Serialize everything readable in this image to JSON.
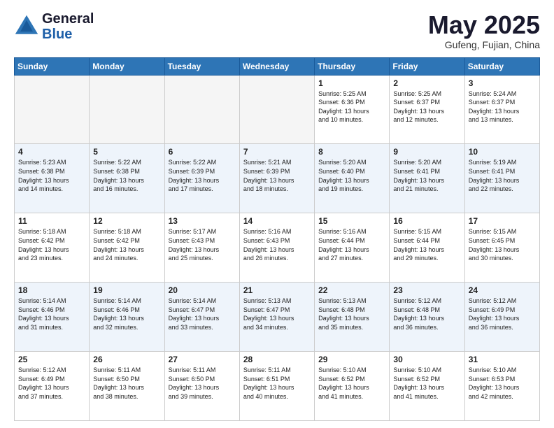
{
  "header": {
    "logo_general": "General",
    "logo_blue": "Blue",
    "month_title": "May 2025",
    "location": "Gufeng, Fujian, China"
  },
  "weekdays": [
    "Sunday",
    "Monday",
    "Tuesday",
    "Wednesday",
    "Thursday",
    "Friday",
    "Saturday"
  ],
  "weeks": [
    [
      {
        "day": "",
        "text": ""
      },
      {
        "day": "",
        "text": ""
      },
      {
        "day": "",
        "text": ""
      },
      {
        "day": "",
        "text": ""
      },
      {
        "day": "1",
        "text": "Sunrise: 5:25 AM\nSunset: 6:36 PM\nDaylight: 13 hours\nand 10 minutes."
      },
      {
        "day": "2",
        "text": "Sunrise: 5:25 AM\nSunset: 6:37 PM\nDaylight: 13 hours\nand 12 minutes."
      },
      {
        "day": "3",
        "text": "Sunrise: 5:24 AM\nSunset: 6:37 PM\nDaylight: 13 hours\nand 13 minutes."
      }
    ],
    [
      {
        "day": "4",
        "text": "Sunrise: 5:23 AM\nSunset: 6:38 PM\nDaylight: 13 hours\nand 14 minutes."
      },
      {
        "day": "5",
        "text": "Sunrise: 5:22 AM\nSunset: 6:38 PM\nDaylight: 13 hours\nand 16 minutes."
      },
      {
        "day": "6",
        "text": "Sunrise: 5:22 AM\nSunset: 6:39 PM\nDaylight: 13 hours\nand 17 minutes."
      },
      {
        "day": "7",
        "text": "Sunrise: 5:21 AM\nSunset: 6:39 PM\nDaylight: 13 hours\nand 18 minutes."
      },
      {
        "day": "8",
        "text": "Sunrise: 5:20 AM\nSunset: 6:40 PM\nDaylight: 13 hours\nand 19 minutes."
      },
      {
        "day": "9",
        "text": "Sunrise: 5:20 AM\nSunset: 6:41 PM\nDaylight: 13 hours\nand 21 minutes."
      },
      {
        "day": "10",
        "text": "Sunrise: 5:19 AM\nSunset: 6:41 PM\nDaylight: 13 hours\nand 22 minutes."
      }
    ],
    [
      {
        "day": "11",
        "text": "Sunrise: 5:18 AM\nSunset: 6:42 PM\nDaylight: 13 hours\nand 23 minutes."
      },
      {
        "day": "12",
        "text": "Sunrise: 5:18 AM\nSunset: 6:42 PM\nDaylight: 13 hours\nand 24 minutes."
      },
      {
        "day": "13",
        "text": "Sunrise: 5:17 AM\nSunset: 6:43 PM\nDaylight: 13 hours\nand 25 minutes."
      },
      {
        "day": "14",
        "text": "Sunrise: 5:16 AM\nSunset: 6:43 PM\nDaylight: 13 hours\nand 26 minutes."
      },
      {
        "day": "15",
        "text": "Sunrise: 5:16 AM\nSunset: 6:44 PM\nDaylight: 13 hours\nand 27 minutes."
      },
      {
        "day": "16",
        "text": "Sunrise: 5:15 AM\nSunset: 6:44 PM\nDaylight: 13 hours\nand 29 minutes."
      },
      {
        "day": "17",
        "text": "Sunrise: 5:15 AM\nSunset: 6:45 PM\nDaylight: 13 hours\nand 30 minutes."
      }
    ],
    [
      {
        "day": "18",
        "text": "Sunrise: 5:14 AM\nSunset: 6:46 PM\nDaylight: 13 hours\nand 31 minutes."
      },
      {
        "day": "19",
        "text": "Sunrise: 5:14 AM\nSunset: 6:46 PM\nDaylight: 13 hours\nand 32 minutes."
      },
      {
        "day": "20",
        "text": "Sunrise: 5:14 AM\nSunset: 6:47 PM\nDaylight: 13 hours\nand 33 minutes."
      },
      {
        "day": "21",
        "text": "Sunrise: 5:13 AM\nSunset: 6:47 PM\nDaylight: 13 hours\nand 34 minutes."
      },
      {
        "day": "22",
        "text": "Sunrise: 5:13 AM\nSunset: 6:48 PM\nDaylight: 13 hours\nand 35 minutes."
      },
      {
        "day": "23",
        "text": "Sunrise: 5:12 AM\nSunset: 6:48 PM\nDaylight: 13 hours\nand 36 minutes."
      },
      {
        "day": "24",
        "text": "Sunrise: 5:12 AM\nSunset: 6:49 PM\nDaylight: 13 hours\nand 36 minutes."
      }
    ],
    [
      {
        "day": "25",
        "text": "Sunrise: 5:12 AM\nSunset: 6:49 PM\nDaylight: 13 hours\nand 37 minutes."
      },
      {
        "day": "26",
        "text": "Sunrise: 5:11 AM\nSunset: 6:50 PM\nDaylight: 13 hours\nand 38 minutes."
      },
      {
        "day": "27",
        "text": "Sunrise: 5:11 AM\nSunset: 6:50 PM\nDaylight: 13 hours\nand 39 minutes."
      },
      {
        "day": "28",
        "text": "Sunrise: 5:11 AM\nSunset: 6:51 PM\nDaylight: 13 hours\nand 40 minutes."
      },
      {
        "day": "29",
        "text": "Sunrise: 5:10 AM\nSunset: 6:52 PM\nDaylight: 13 hours\nand 41 minutes."
      },
      {
        "day": "30",
        "text": "Sunrise: 5:10 AM\nSunset: 6:52 PM\nDaylight: 13 hours\nand 41 minutes."
      },
      {
        "day": "31",
        "text": "Sunrise: 5:10 AM\nSunset: 6:53 PM\nDaylight: 13 hours\nand 42 minutes."
      }
    ]
  ]
}
